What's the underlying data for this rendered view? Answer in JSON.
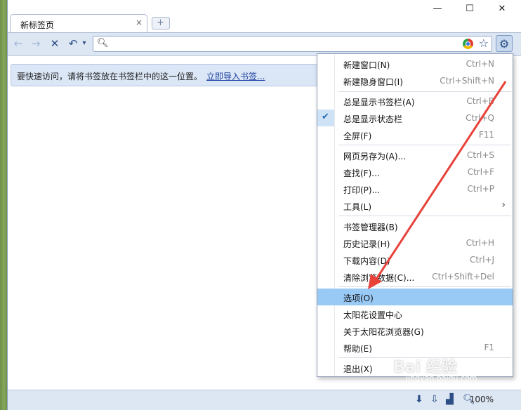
{
  "tab": {
    "title": "新标签页",
    "close": "×",
    "new_tab": "+"
  },
  "window_controls": {
    "minimize": "—",
    "maximize": "☐",
    "close": "✕"
  },
  "toolbar": {
    "back": "←",
    "forward": "→",
    "stop": "✕",
    "undo": "↶",
    "undo_menu": "▾"
  },
  "omnibox": {
    "value": "",
    "placeholder": ""
  },
  "bookmark_bar": {
    "message": "要快速访问，请将书签放在书签栏中的这一位置。",
    "import_link": "立即导入书签..."
  },
  "status": {
    "zoom": "100%"
  },
  "menu": {
    "items": [
      {
        "label": "新建窗口(N)",
        "shortcut": "Ctrl+N"
      },
      {
        "label": "新建隐身窗口(I)",
        "shortcut": "Ctrl+Shift+N"
      },
      {
        "label": "总是显示书签栏(A)",
        "shortcut": "Ctrl+B"
      },
      {
        "label": "总是显示状态栏",
        "shortcut": "Ctrl+Q",
        "checked": true
      },
      {
        "label": "全屏(F)",
        "shortcut": "F11"
      },
      {
        "label": "网页另存为(A)...",
        "shortcut": "Ctrl+S"
      },
      {
        "label": "查找(F)...",
        "shortcut": "Ctrl+F"
      },
      {
        "label": "打印(P)...",
        "shortcut": "Ctrl+P"
      },
      {
        "label": "工具(L)",
        "shortcut": "",
        "submenu": true
      },
      {
        "label": "书签管理器(B)",
        "shortcut": ""
      },
      {
        "label": "历史记录(H)",
        "shortcut": "Ctrl+H"
      },
      {
        "label": "下载内容(D)",
        "shortcut": "Ctrl+J"
      },
      {
        "label": "清除浏览数据(C)...",
        "shortcut": "Ctrl+Shift+Del"
      },
      {
        "label": "选项(O)",
        "shortcut": "",
        "selected": true
      },
      {
        "label": "太阳花设置中心",
        "shortcut": ""
      },
      {
        "label": "关于太阳花浏览器(G)",
        "shortcut": ""
      },
      {
        "label": "帮助(E)",
        "shortcut": "F1"
      },
      {
        "label": "退出(X)",
        "shortcut": ""
      }
    ]
  },
  "watermark": {
    "text": "Bai 经验",
    "sub": "jingyan.baidu.com"
  },
  "colors": {
    "accent": "#99c9f5",
    "arrow": "#e8413a",
    "toolbar": "#dde6f3"
  }
}
